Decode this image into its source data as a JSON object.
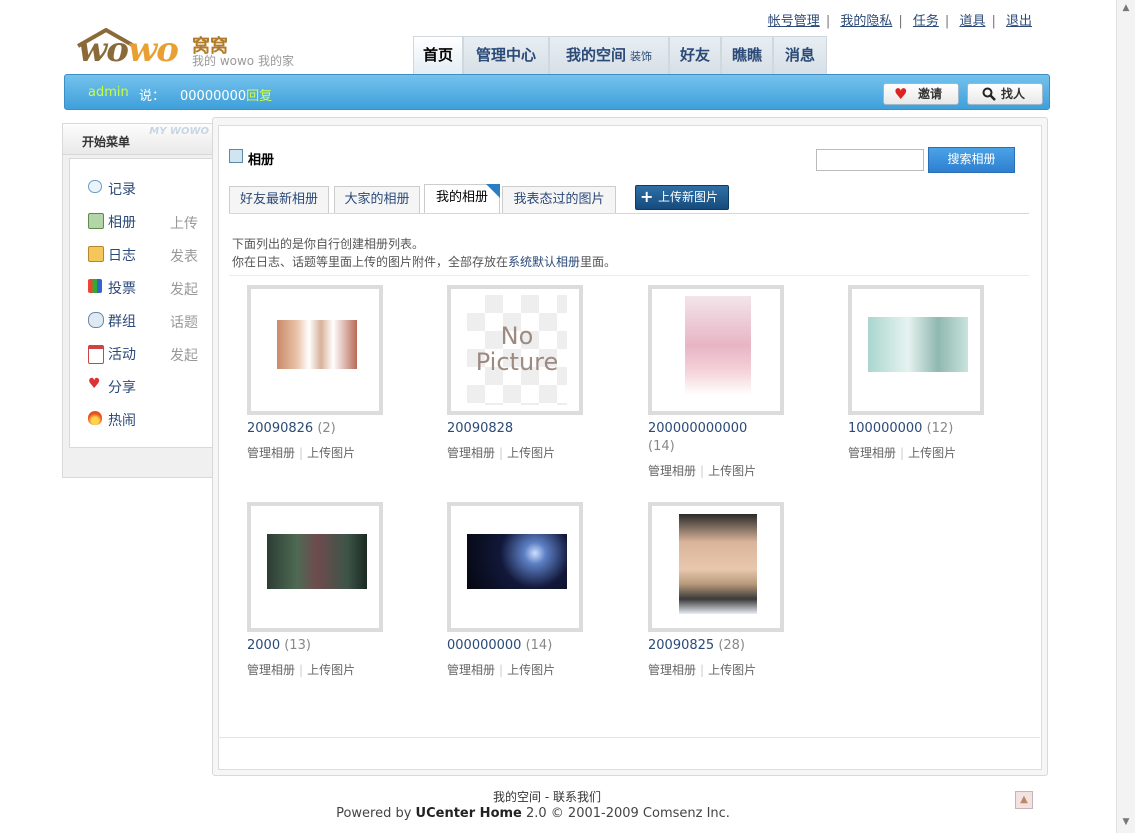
{
  "toplinks": {
    "account": "帐号管理",
    "privacy": "我的隐私",
    "task": "任务",
    "props": "道具",
    "logout": "退出",
    "sep": "|"
  },
  "logo": {
    "text_a": "wo",
    "text_b": "wo",
    "cn": "窝窝",
    "sub": "我的 wowo 我的家"
  },
  "nav": {
    "home": "首页",
    "admin": "管理中心",
    "myspace": "我的空间",
    "decorate": "装饰",
    "friends": "好友",
    "look": "瞧瞧",
    "messages": "消息"
  },
  "bluebar": {
    "user": "admin",
    "say": "说：",
    "status": "00000000",
    "reply": "回复",
    "invite": "邀请",
    "find": "找人"
  },
  "sidebar": {
    "title": "开始菜单",
    "deco": "MY WOWO",
    "items": [
      {
        "label": "记录",
        "action": ""
      },
      {
        "label": "相册",
        "action": "上传"
      },
      {
        "label": "日志",
        "action": "发表"
      },
      {
        "label": "投票",
        "action": "发起"
      },
      {
        "label": "群组",
        "action": "话题"
      },
      {
        "label": "活动",
        "action": "发起"
      },
      {
        "label": "分享",
        "action": ""
      },
      {
        "label": "热闹",
        "action": ""
      }
    ]
  },
  "page": {
    "title": "相册",
    "search_button": "搜索相册",
    "search_value": ""
  },
  "tabs": {
    "friends_latest": "好友最新相册",
    "everyone": "大家的相册",
    "mine": "我的相册",
    "liked": "我表态过的图片",
    "upload": "上传新图片"
  },
  "info": {
    "line1": "下面列出的是你自行创建相册列表。",
    "line2_a": "你在日志、话题等里面上传的图片附件，全部存放在",
    "line2_link": "系统默认相册",
    "line2_b": "里面。"
  },
  "albums": [
    {
      "name": "20090826",
      "count": "(2)"
    },
    {
      "name": "20090828",
      "count": ""
    },
    {
      "name": "200000000000",
      "count": "(14)"
    },
    {
      "name": "100000000",
      "count": "(12)"
    },
    {
      "name": "2000",
      "count": "(13)"
    },
    {
      "name": "000000000",
      "count": "(14)"
    },
    {
      "name": "20090825",
      "count": "(28)"
    }
  ],
  "album_actions": {
    "manage": "管理相册",
    "upload": "上传图片",
    "sep": "|"
  },
  "nopic": {
    "line1": "No",
    "line2": "Picture"
  },
  "footer": {
    "myspace": "我的空间",
    "contact": "- 联系我们",
    "powered_a": "Powered by ",
    "powered_b": "UCenter Home",
    "powered_c": " 2.0 © 2001-2009 Comsenz Inc."
  }
}
